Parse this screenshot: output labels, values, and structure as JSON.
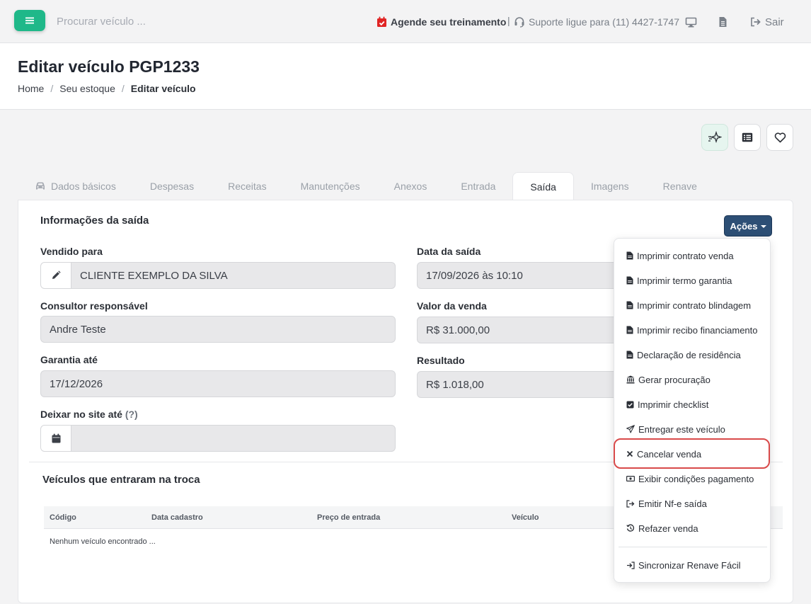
{
  "topbar": {
    "search_placeholder": "Procurar veículo ...",
    "training_label": "Agende seu treinamento",
    "separator": "|",
    "support_label": "Suporte ligue para (11) 4427-1747",
    "logout_label": "Sair"
  },
  "header": {
    "title": "Editar veículo PGP1233",
    "breadcrumb": [
      "Home",
      "Seu estoque",
      "Editar veículo"
    ]
  },
  "tabs": [
    "Dados básicos",
    "Despesas",
    "Receitas",
    "Manutenções",
    "Anexos",
    "Entrada",
    "Saída",
    "Imagens",
    "Renave"
  ],
  "active_tab": "Saída",
  "card": {
    "title": "Informações da saída",
    "actions_label": "Ações",
    "fields": {
      "sold_to_label": "Vendido para",
      "sold_to_value": "CLIENTE EXEMPLO DA SILVA",
      "sale_date_label": "Data da saída",
      "sale_date_value": "17/09/2026 às 10:10",
      "consultant_label": "Consultor responsável",
      "consultant_value": "Andre Teste",
      "sale_value_label": "Valor da venda",
      "sale_value_value": "R$ 31.000,00",
      "warranty_label": "Garantia até",
      "warranty_value": "17/12/2026",
      "result_label": "Resultado",
      "result_value": "R$ 1.018,00",
      "site_label": "Deixar no site até",
      "site_help": "(?)",
      "site_value": ""
    },
    "trade_section": {
      "title": "Veículos que entraram na troca",
      "columns": [
        "Código",
        "Data cadastro",
        "Preço de entrada",
        "Veículo"
      ],
      "empty_text": "Nenhum veículo encontrado ..."
    }
  },
  "actions_menu": {
    "items": [
      {
        "label": "Imprimir contrato venda",
        "icon": "file-icon"
      },
      {
        "label": "Imprimir termo garantia",
        "icon": "file-icon"
      },
      {
        "label": "Imprimir contrato blindagem",
        "icon": "file-icon"
      },
      {
        "label": "Imprimir recibo financiamento",
        "icon": "file-icon"
      },
      {
        "label": "Declaração de residência",
        "icon": "file-icon"
      },
      {
        "label": "Gerar procuração",
        "icon": "bank-icon"
      },
      {
        "label": "Imprimir checklist",
        "icon": "checkbox-icon"
      },
      {
        "label": "Entregar este veículo",
        "icon": "send-icon"
      },
      {
        "label": "Cancelar venda",
        "icon": "close-icon"
      },
      {
        "label": "Exibir condições pagamento",
        "icon": "money-icon"
      },
      {
        "label": "Emitir Nf-e saída",
        "icon": "sign-out-icon"
      },
      {
        "label": "Refazer venda",
        "icon": "history-icon"
      }
    ],
    "footer_item": {
      "label": "Sincronizar Renave Fácil",
      "icon": "sign-in-icon"
    },
    "highlight_color": "#d94a4a"
  },
  "colors": {
    "accent": "#1fb889",
    "actions_button": "#2d4f75",
    "highlight": "#d94a4a"
  }
}
